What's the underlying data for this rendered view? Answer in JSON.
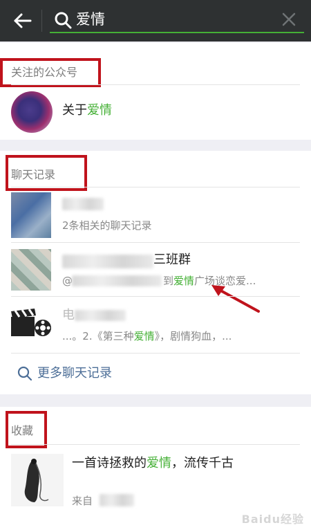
{
  "search": {
    "query": "爱情"
  },
  "sections": {
    "official_accounts": {
      "title": "关注的公众号",
      "item": {
        "prefix": "关于",
        "highlight": "爱情"
      }
    },
    "chat_history": {
      "title": "聊天记录",
      "items": [
        {
          "name": "",
          "snippet": "2条相关的聊天记录"
        },
        {
          "name_suffix": "三班群",
          "snippet_prefix": "@",
          "snippet_mid": "到",
          "snippet_highlight": "爱情",
          "snippet_suffix": "广场谈恋爱..."
        },
        {
          "name_prefix": "电",
          "snippet_prefix": "...。2.《第三种",
          "snippet_highlight": "爱情",
          "snippet_suffix": "》，剧情狗血，..."
        }
      ],
      "more_label": "更多聊天记录"
    },
    "favorites": {
      "title": "收藏",
      "item": {
        "prefix": "一首诗拯救的",
        "highlight": "爱情",
        "suffix": "，流传千古",
        "source_prefix": "来自"
      }
    }
  },
  "watermark": "Baidu经验",
  "colors": {
    "accent": "#45b036",
    "annotation": "#c0131c",
    "link": "#4c6e97",
    "topbar": "#2e3132"
  }
}
